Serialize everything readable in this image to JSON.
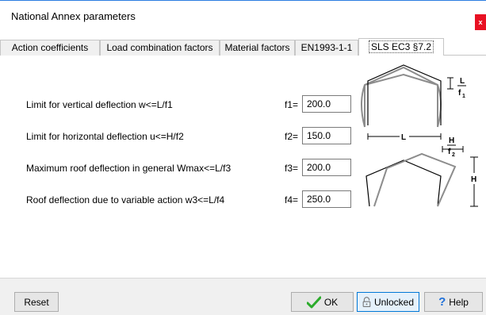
{
  "window": {
    "title": "National Annex parameters",
    "close_label": "x"
  },
  "tabs": [
    {
      "label": "Action coefficients",
      "active": false
    },
    {
      "label": "Load combination factors",
      "active": false
    },
    {
      "label": "Material factors",
      "active": false
    },
    {
      "label": "EN1993-1-1",
      "active": false
    },
    {
      "label": "SLS EC3 §7.2",
      "active": true
    }
  ],
  "params": [
    {
      "label": "Limit for vertical deflection w<=L/f1",
      "name": "f1=",
      "value": "200.0"
    },
    {
      "label": "Limit for horizontal deflection u<=H/f2",
      "name": "f2=",
      "value": "150.0"
    },
    {
      "label": "Maximum roof deflection in general Wmax<=L/f3",
      "name": "f3=",
      "value": "200.0"
    },
    {
      "label": "Roof deflection due to variable action w3<=L/f4",
      "name": "f4=",
      "value": "250.0"
    }
  ],
  "diagram": {
    "top_frac_num": "L",
    "top_frac_den": "f",
    "top_frac_sub": "1",
    "span_label": "L",
    "side_frac_num": "H",
    "side_frac_den": "f",
    "side_frac_sub": "2",
    "height_label": "H"
  },
  "buttons": {
    "reset": "Reset",
    "ok": "OK",
    "unlocked": "Unlocked",
    "help": "Help"
  },
  "icons": {
    "ok": "check-icon",
    "unlocked": "padlock-icon",
    "help": "question-icon"
  },
  "colors": {
    "accent": "#2b7de1",
    "ok_check": "#2bab2b",
    "help_icon": "#1e6fd9",
    "close": "#e81123"
  }
}
